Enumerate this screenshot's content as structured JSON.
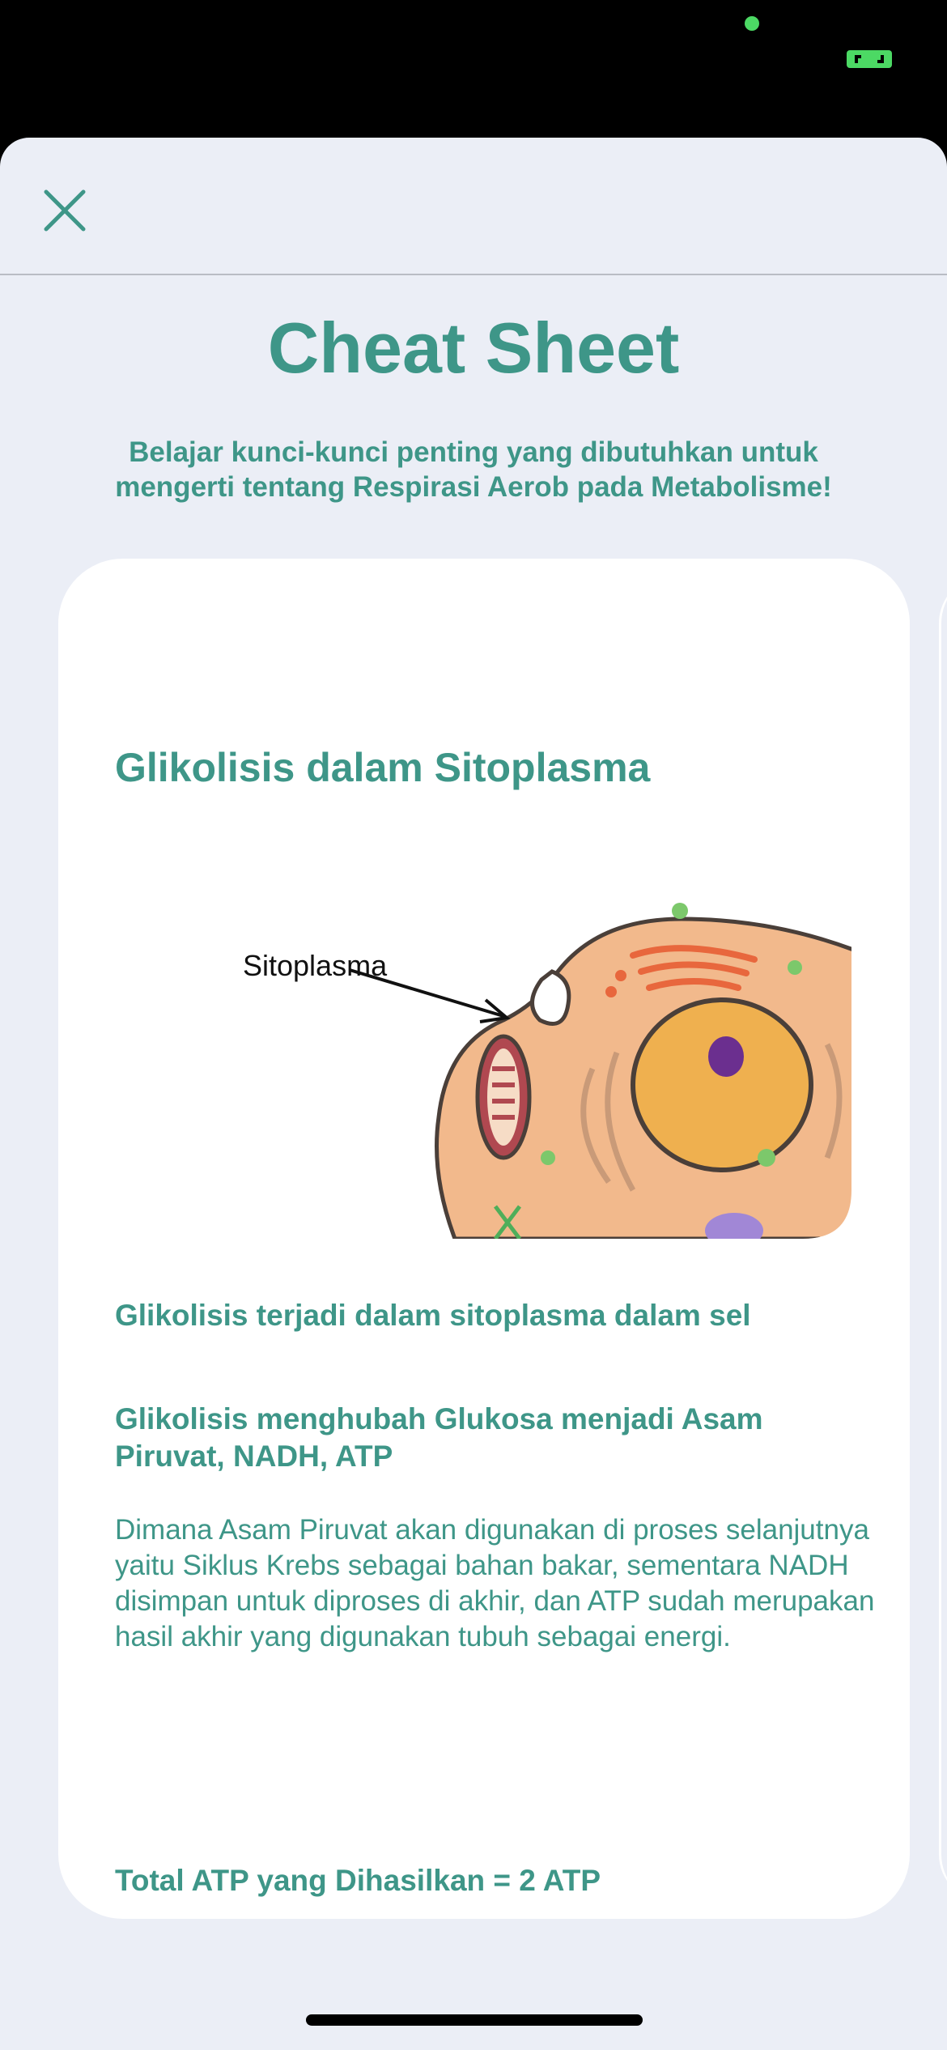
{
  "colors": {
    "accent": "#3e9688",
    "sheet_background": "#ebeef6",
    "card_background": "#ffffff",
    "status_indicator": "#4cd964"
  },
  "header": {
    "close_icon": "close-icon"
  },
  "page": {
    "title": "Cheat Sheet",
    "subtitle": "Belajar kunci-kunci penting yang dibutuhkan untuk mengerti tentang Respirasi Aerob pada Metabolisme!"
  },
  "card": {
    "title": "Glikolisis dalam Sitoplasma",
    "image_label": "Sitoplasma",
    "point_1": "Glikolisis terjadi dalam sitoplasma dalam sel",
    "point_2": "Glikolisis menghubah Glukosa menjadi Asam Piruvat, NADH, ATP",
    "description": "Dimana Asam Piruvat akan digunakan di proses selanjutnya yaitu Siklus Krebs sebagai bahan bakar, sementara NADH disimpan untuk diproses di akhir, dan ATP sudah merupakan hasil akhir yang digunakan tubuh sebagai energi.",
    "total": "Total ATP yang Dihasilkan = 2 ATP"
  }
}
